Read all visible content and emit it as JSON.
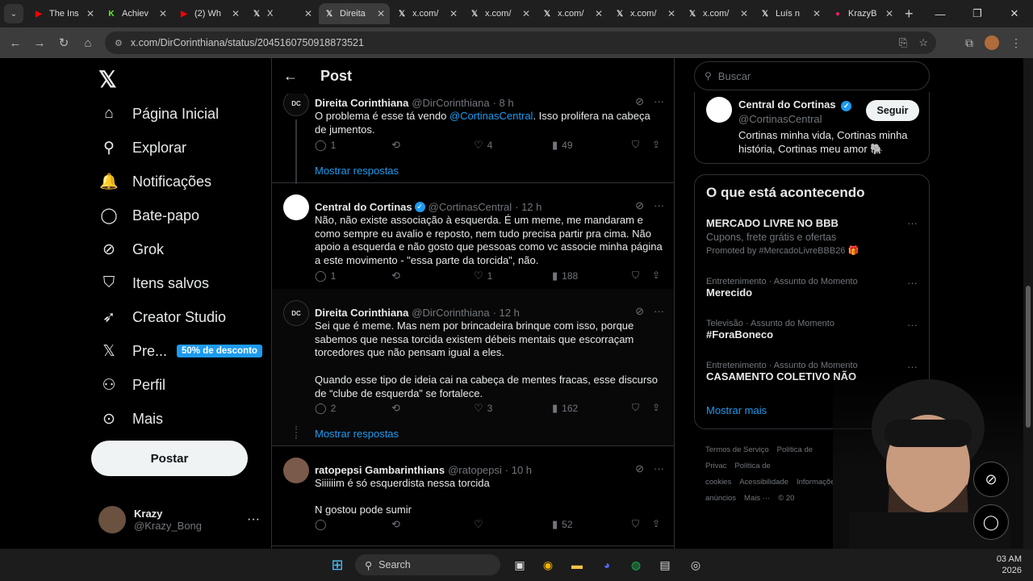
{
  "browser": {
    "tabs": [
      {
        "title": "The Ins",
        "fav": "▶",
        "color": "#ff0000"
      },
      {
        "title": "Achiev",
        "fav": "K",
        "color": "#53fc18"
      },
      {
        "title": "(2) Wh",
        "fav": "▶",
        "color": "#ff0000"
      },
      {
        "title": "X",
        "fav": "𝕏",
        "color": "#000000"
      },
      {
        "title": "Direita",
        "fav": "𝕏",
        "color": "#000000",
        "active": true
      },
      {
        "title": "x.com/",
        "fav": "𝕏",
        "color": "#000000"
      },
      {
        "title": "x.com/",
        "fav": "𝕏",
        "color": "#000000"
      },
      {
        "title": "x.com/",
        "fav": "𝕏",
        "color": "#000000"
      },
      {
        "title": "x.com/",
        "fav": "𝕏",
        "color": "#000000"
      },
      {
        "title": "x.com/",
        "fav": "𝕏",
        "color": "#000000"
      },
      {
        "title": "Luís n",
        "fav": "𝕏",
        "color": "#000000"
      },
      {
        "title": "KrazyB",
        "fav": "●",
        "color": "#e0245e"
      }
    ],
    "url": "x.com/DirCorinthiana/status/2045160750918873521"
  },
  "nav": {
    "items": [
      {
        "label": "Página Inicial",
        "icon": "⌂",
        "name": "home"
      },
      {
        "label": "Explorar",
        "icon": "⚲",
        "name": "explore"
      },
      {
        "label": "Notificações",
        "icon": "🔔",
        "name": "notifications"
      },
      {
        "label": "Bate-papo",
        "icon": "◯",
        "name": "chat"
      },
      {
        "label": "Grok",
        "icon": "⊘",
        "name": "grok"
      },
      {
        "label": "Itens salvos",
        "icon": "⛉",
        "name": "bookmarks"
      },
      {
        "label": "Creator Studio",
        "icon": "➶",
        "name": "creator-studio"
      },
      {
        "label": "Pre...",
        "icon": "𝕏",
        "name": "premium"
      },
      {
        "label": "Perfil",
        "icon": "⚇",
        "name": "profile"
      },
      {
        "label": "Mais",
        "icon": "⊙",
        "name": "more"
      }
    ],
    "promo": "50% de desconto",
    "post_label": "Postar",
    "account": {
      "name": "Krazy",
      "handle": "@Krazy_Bong"
    }
  },
  "main": {
    "title": "Post",
    "tweets": [
      {
        "name": "Direita Corinthiana",
        "handle": "@DirCorinthiana",
        "time": "· 8 h",
        "verified": false,
        "body_pre": "O problema é esse tá vendo ",
        "mention": "@CortinasCentral",
        "body_post": ". Isso prolifera na cabeça de jumentos.",
        "replies": "1",
        "reposts": "",
        "likes": "4",
        "views": "49",
        "show_replies": "Mostrar respostas"
      },
      {
        "name": "Central do Cortinas",
        "handle": "@CortinasCentral",
        "time": "· 12 h",
        "verified": true,
        "body": "Não, não existe associação à esquerda. É um meme, me mandaram e como sempre eu avalio e reposto, nem tudo precisa partir pra cima. Não apoio a esquerda e não gosto que pessoas como vc associe minha página a este movimento - \"essa parte da torcida\", não.",
        "replies": "1",
        "reposts": "",
        "likes": "1",
        "views": "188"
      },
      {
        "name": "Direita Corinthiana",
        "handle": "@DirCorinthiana",
        "time": "· 12 h",
        "verified": false,
        "body": "Sei que é meme. Mas nem por brincadeira brinque com isso, porque sabemos que nessa torcida existem débeis mentais que escorraçam torcedores que não pensam igual a eles.\n\nQuando esse tipo de ideia cai na cabeça de mentes fracas, esse discurso de “clube de esquerda” se fortalece.",
        "replies": "2",
        "reposts": "",
        "likes": "3",
        "views": "162",
        "show_replies": "Mostrar respostas"
      },
      {
        "name": "ratopepsi Gambarinthians",
        "handle": "@ratopepsi",
        "time": "· 10 h",
        "verified": false,
        "body": "Siiiiiim é só esquerdista nessa torcida\n\nN gostou pode sumir",
        "replies": "",
        "reposts": "",
        "likes": "",
        "views": "52"
      }
    ]
  },
  "sidebar": {
    "search_placeholder": "Buscar",
    "profile_card": {
      "name": "Central do Cortinas",
      "handle": "@CortinasCentral",
      "bio": "Cortinas minha vida, Cortinas minha história, Cortinas meu amor 🐘",
      "follow_label": "Seguir"
    },
    "trends_title": "O que está acontecendo",
    "trends": [
      {
        "ctx": "",
        "name": "MERCADO LIVRE NO BBB",
        "sub": "Cupons, frete grátis e ofertas",
        "promo": "Promoted by #MercadoLivreBBB26 🎁"
      },
      {
        "ctx": "Entretenimento · Assunto do Momento",
        "name": "Merecido",
        "sub": "",
        "promo": ""
      },
      {
        "ctx": "Televisão · Assunto do Momento",
        "name": "#ForaBoneco",
        "sub": "",
        "promo": ""
      },
      {
        "ctx": "Entretenimento · Assunto do Momento",
        "name": "CASAMENTO COLETIVO NÃO",
        "sub": "",
        "promo": ""
      }
    ],
    "show_more": "Mostrar mais",
    "footer": [
      "Termos de Serviço",
      "Política de Privac",
      "Política de cookies",
      "Acessibilidade",
      "Informações de anúncios",
      "Mais ···",
      "© 20"
    ]
  },
  "taskbar": {
    "search": "Search",
    "clock_time": "03 AM",
    "clock_date": "2026"
  }
}
